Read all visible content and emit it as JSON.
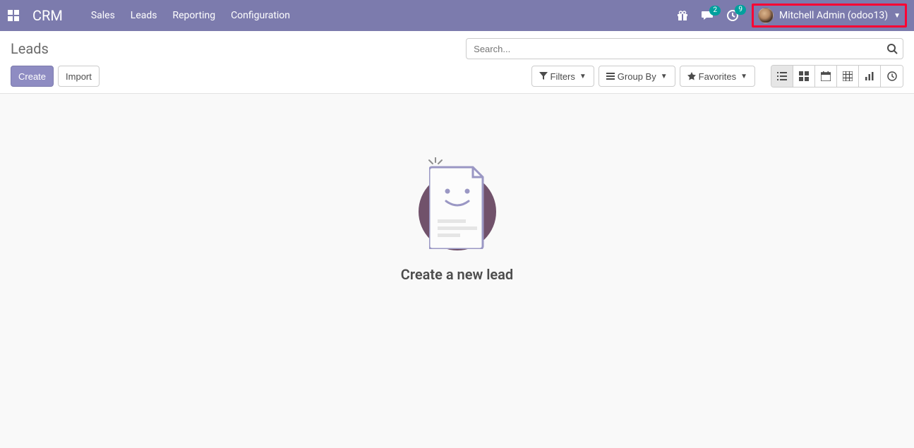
{
  "navbar": {
    "brand": "CRM",
    "links": [
      {
        "label": "Sales"
      },
      {
        "label": "Leads"
      },
      {
        "label": "Reporting"
      },
      {
        "label": "Configuration"
      }
    ],
    "messages_badge": "2",
    "activities_badge": "9",
    "user_name": "Mitchell Admin (odoo13)"
  },
  "control_panel": {
    "title": "Leads",
    "search_placeholder": "Search...",
    "create_label": "Create",
    "import_label": "Import",
    "filters_label": "Filters",
    "group_by_label": "Group By",
    "favorites_label": "Favorites"
  },
  "empty_state": {
    "title": "Create a new lead"
  },
  "colors": {
    "primary": "#7c7bad",
    "accent": "#00a09d",
    "highlight_border": "#ff0033"
  }
}
